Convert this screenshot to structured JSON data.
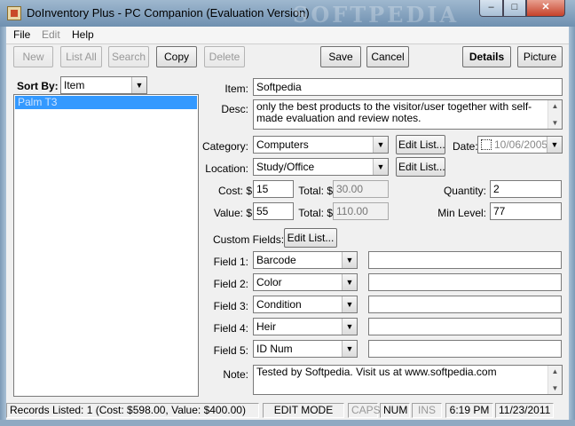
{
  "window": {
    "title": "DoInventory Plus - PC Companion (Evaluation Version)",
    "watermark": "SOFTPEDIA",
    "min_glyph": "–",
    "max_glyph": "□",
    "close_glyph": "✕"
  },
  "menu": [
    "File",
    "Edit",
    "Help"
  ],
  "toolbar": {
    "new": "New",
    "list_all": "List All",
    "search": "Search",
    "copy": "Copy",
    "delete": "Delete",
    "save": "Save",
    "cancel": "Cancel",
    "details": "Details",
    "picture": "Picture"
  },
  "sidebar": {
    "sort_label": "Sort By:",
    "sort_value": "Item",
    "items": [
      "Palm T3"
    ]
  },
  "form": {
    "item_label": "Item:",
    "item_value": "Softpedia",
    "desc_label": "Desc:",
    "desc_value": "only the best products to the visitor/user together with self-made evaluation and review notes.",
    "category_label": "Category:",
    "category_value": "Computers",
    "location_label": "Location:",
    "location_value": "Study/Office",
    "edit_list": "Edit List...",
    "date_label": "Date:",
    "date_value": "10/06/2005",
    "cost_label": "Cost: $",
    "cost_value": "15",
    "total_label": "Total: $",
    "cost_total": "30.00",
    "value_label": "Value: $",
    "value_value": "55",
    "value_total": "110.00",
    "quantity_label": "Quantity:",
    "quantity_value": "2",
    "min_level_label": "Min Level:",
    "min_level_value": "77",
    "custom_fields_label": "Custom Fields:",
    "custom_edit_list": "Edit List...",
    "fields": [
      {
        "label": "Field 1:",
        "name": "Barcode",
        "value": ""
      },
      {
        "label": "Field 2:",
        "name": "Color",
        "value": ""
      },
      {
        "label": "Field 3:",
        "name": "Condition",
        "value": ""
      },
      {
        "label": "Field 4:",
        "name": "Heir",
        "value": ""
      },
      {
        "label": "Field 5:",
        "name": "ID Num",
        "value": ""
      }
    ],
    "note_label": "Note:",
    "note_value": "Tested by Softpedia. Visit us at www.softpedia.com"
  },
  "status": {
    "records": "Records Listed: 1  (Cost: $598.00, Value: $400.00)",
    "mode": "EDIT MODE",
    "caps": "CAPS",
    "num": "NUM",
    "ins": "INS",
    "time": "6:19 PM",
    "date": "11/23/2011"
  }
}
